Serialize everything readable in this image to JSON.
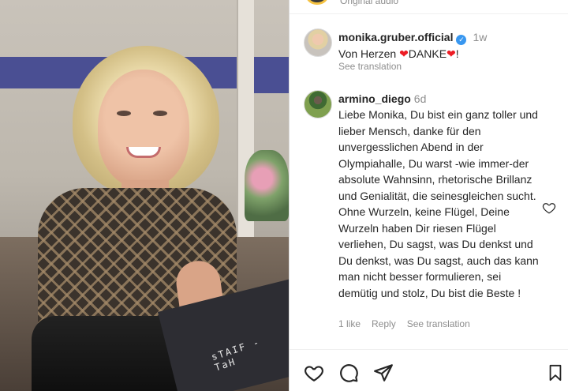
{
  "post_image": {
    "stencil_text": "sTAIF - TaH"
  },
  "audio_bar": {
    "label": "Original audio"
  },
  "caption": {
    "username": "monika.gruber.official",
    "verified": true,
    "timeago": "1w",
    "text_before": "Von Herzen ",
    "heart1": "❤",
    "text_middle": "DANKE",
    "heart2": "❤",
    "text_after": "!",
    "see_translation": "See translation"
  },
  "comment": {
    "username": "armino_diego",
    "timeago": "6d",
    "text": "Liebe Monika, Du bist ein ganz toller und lieber Mensch, danke für den unvergesslichen Abend in der Olympiahalle, Du warst -wie immer-der absolute Wahnsinn, rhetorische Brillanz und Genialität, die seinesgleichen sucht. Ohne Wurzeln, keine Flügel, Deine Wurzeln haben Dir riesen Flügel verliehen, Du sagst, was Du denkst und Du denkst, was Du sagst, auch das kann man nicht besser formulieren, sei demütig und stolz, Du bist die Beste !",
    "likes": "1 like",
    "reply": "Reply",
    "see_translation": "See translation"
  },
  "actions": {
    "like": "heart-icon",
    "comment": "comment-icon",
    "share": "share-icon",
    "save": "bookmark-icon"
  },
  "colors": {
    "verified_badge": "#3897f0",
    "heart": "#ed1c24",
    "secondary_text": "#8e8e8e"
  }
}
